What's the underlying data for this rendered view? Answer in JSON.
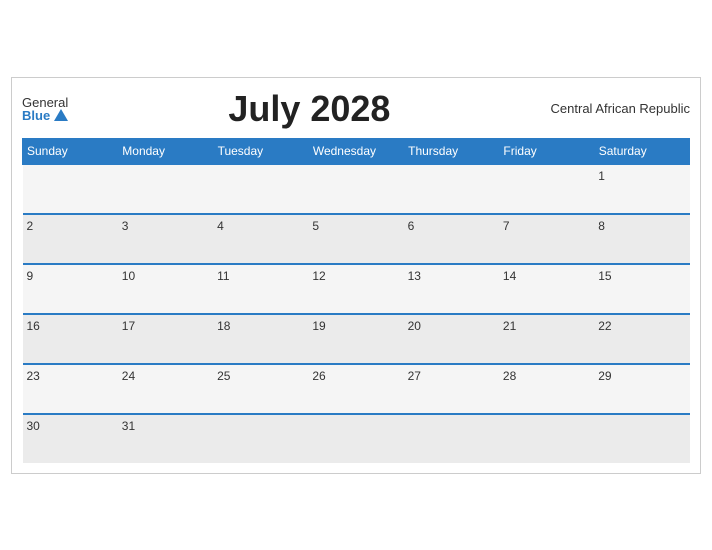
{
  "header": {
    "logo_general": "General",
    "logo_blue": "Blue",
    "title": "July 2028",
    "country": "Central African Republic"
  },
  "days_of_week": [
    "Sunday",
    "Monday",
    "Tuesday",
    "Wednesday",
    "Thursday",
    "Friday",
    "Saturday"
  ],
  "weeks": [
    [
      "",
      "",
      "",
      "",
      "",
      "",
      "1"
    ],
    [
      "2",
      "3",
      "4",
      "5",
      "6",
      "7",
      "8"
    ],
    [
      "9",
      "10",
      "11",
      "12",
      "13",
      "14",
      "15"
    ],
    [
      "16",
      "17",
      "18",
      "19",
      "20",
      "21",
      "22"
    ],
    [
      "23",
      "24",
      "25",
      "26",
      "27",
      "28",
      "29"
    ],
    [
      "30",
      "31",
      "",
      "",
      "",
      "",
      ""
    ]
  ]
}
